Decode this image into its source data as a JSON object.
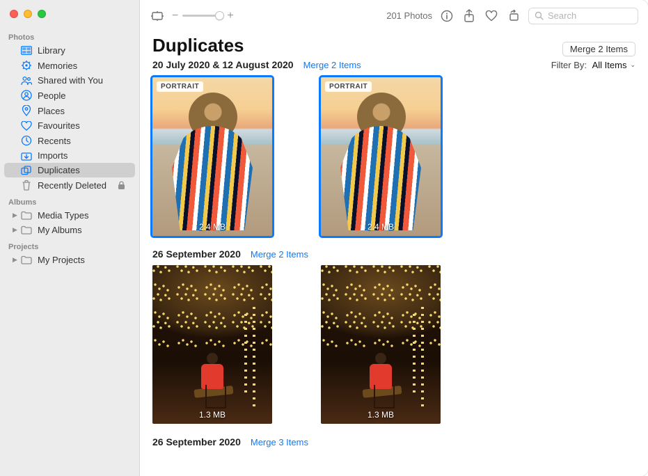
{
  "sidebar": {
    "groups": [
      {
        "label": "Photos",
        "items": [
          {
            "label": "Library",
            "icon": "library"
          },
          {
            "label": "Memories",
            "icon": "memories"
          },
          {
            "label": "Shared with You",
            "icon": "shared"
          },
          {
            "label": "People",
            "icon": "people"
          },
          {
            "label": "Places",
            "icon": "places"
          },
          {
            "label": "Favourites",
            "icon": "heart"
          },
          {
            "label": "Recents",
            "icon": "clock"
          },
          {
            "label": "Imports",
            "icon": "imports"
          },
          {
            "label": "Duplicates",
            "icon": "duplicates",
            "selected": true
          },
          {
            "label": "Recently Deleted",
            "icon": "trash",
            "locked": true
          }
        ]
      },
      {
        "label": "Albums",
        "items": [
          {
            "label": "Media Types",
            "icon": "folder",
            "chevron": true
          },
          {
            "label": "My Albums",
            "icon": "folder",
            "chevron": true
          }
        ]
      },
      {
        "label": "Projects",
        "items": [
          {
            "label": "My Projects",
            "icon": "folder",
            "chevron": true
          }
        ]
      }
    ]
  },
  "toolbar": {
    "zoom_minus": "−",
    "zoom_plus": "+",
    "count": "201 Photos",
    "search_placeholder": "Search"
  },
  "page": {
    "title": "Duplicates",
    "merge_top_button": "Merge 2 Items",
    "filter_label": "Filter By:",
    "filter_value": "All Items"
  },
  "sections": [
    {
      "date": "20 July 2020  & 12 August 2020",
      "merge_link": "Merge 2 Items",
      "photos": [
        {
          "badge": "PORTRAIT",
          "size": "2.4 MB",
          "selected": true,
          "art": "photo1"
        },
        {
          "badge": "PORTRAIT",
          "size": "2.4 MB",
          "selected": true,
          "art": "photo1"
        }
      ]
    },
    {
      "date": "26 September 2020",
      "merge_link": "Merge 2 Items",
      "photos": [
        {
          "size": "1.3 MB",
          "art": "photo2"
        },
        {
          "size": "1.3 MB",
          "art": "photo2"
        }
      ]
    },
    {
      "date": "26 September 2020",
      "merge_link": "Merge 3 Items",
      "photos": []
    }
  ]
}
